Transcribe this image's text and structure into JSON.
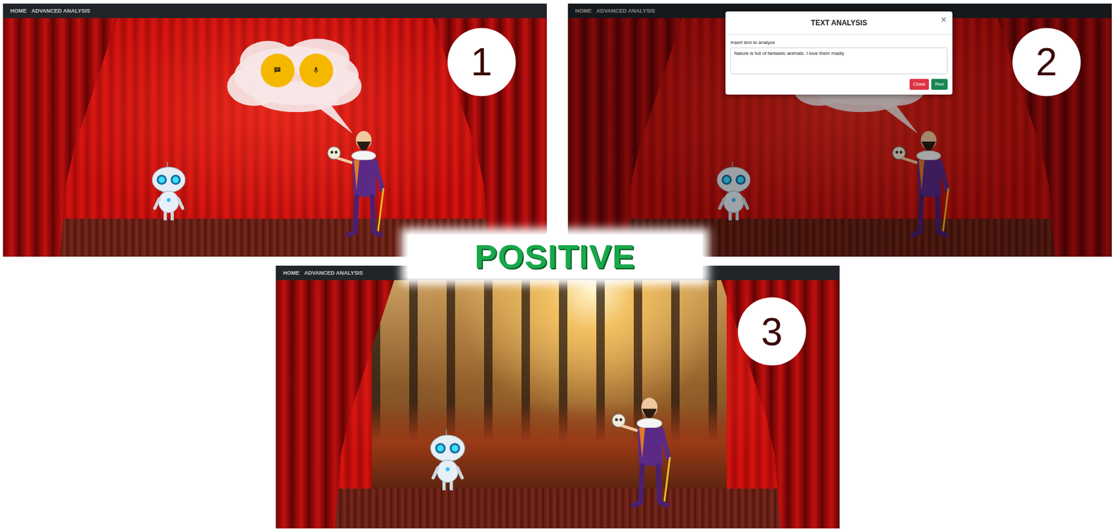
{
  "panels": [
    {
      "number": "1",
      "kind": "stage",
      "nav": [
        {
          "label": "HOME"
        },
        {
          "label": "ADVANCED ANALYSIS"
        }
      ],
      "bubble": true,
      "dimmed": false
    },
    {
      "number": "2",
      "kind": "stage",
      "nav": [
        {
          "label": "HOME"
        },
        {
          "label": "ADVANCED ANALYSIS"
        }
      ],
      "bubble": true,
      "dimmed": true,
      "dialog": {
        "title": "TEXT ANALYSIS",
        "close_icon": "×",
        "label": "Insert text to analyze",
        "value": "Nature is full of fantastic animals. I love them madly",
        "buttons": [
          {
            "label": "Close",
            "color": "#dc3545"
          },
          {
            "label": "Run",
            "color": "#198754"
          }
        ]
      }
    },
    {
      "number": "3",
      "kind": "forest",
      "nav": [
        {
          "label": "HOME"
        },
        {
          "label": "ADVANCED ANALYSIS"
        }
      ],
      "bubble": false,
      "dimmed": false
    }
  ],
  "result_label": "POSITIVE"
}
